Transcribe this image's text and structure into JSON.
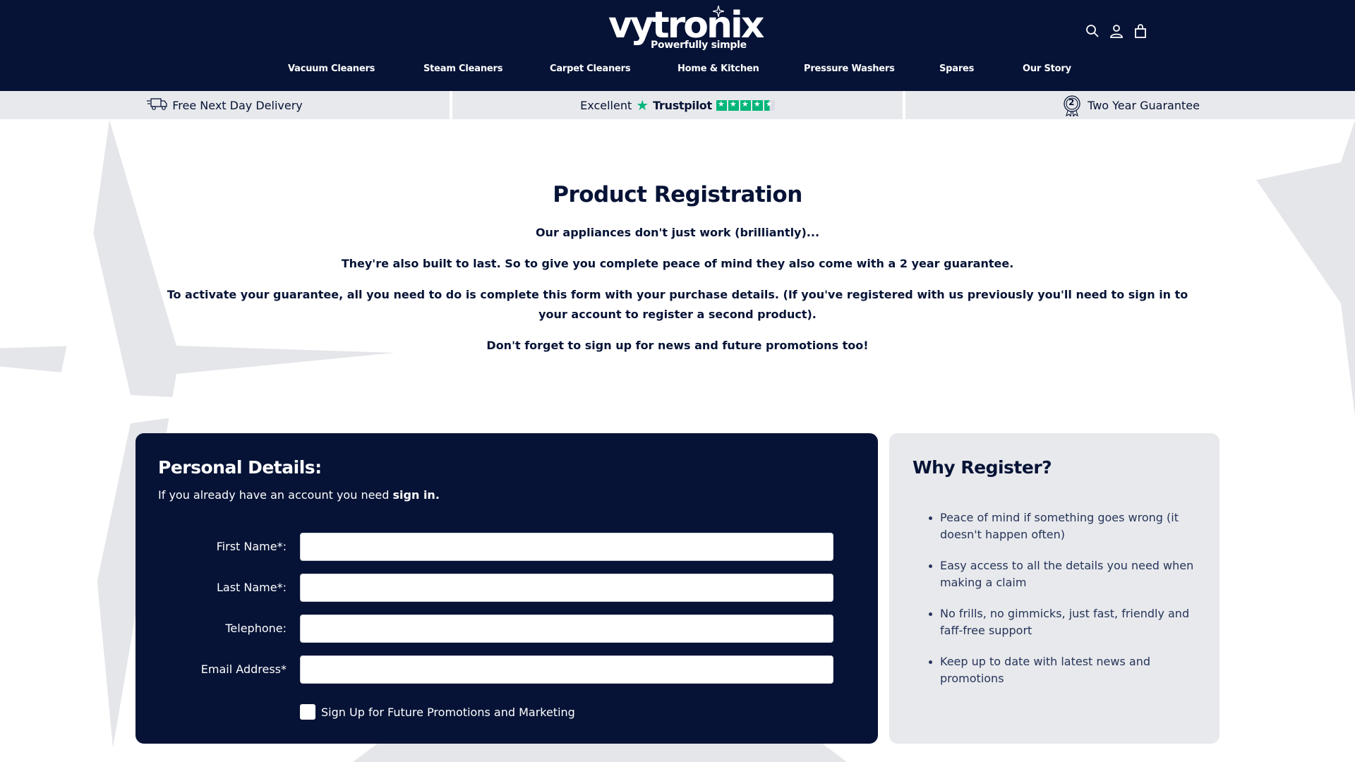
{
  "brand": {
    "name": "vytronix",
    "tagline": "Powerfully simple"
  },
  "header": {
    "icons": [
      "search-icon",
      "account-icon",
      "cart-icon"
    ]
  },
  "nav": {
    "items": [
      {
        "label": "Vacuum Cleaners"
      },
      {
        "label": "Steam Cleaners"
      },
      {
        "label": "Carpet Cleaners"
      },
      {
        "label": "Home & Kitchen"
      },
      {
        "label": "Pressure Washers"
      },
      {
        "label": "Spares"
      },
      {
        "label": "Our Story"
      }
    ]
  },
  "usp": {
    "delivery": "Free Next Day Delivery",
    "trustpilot_rating": "Excellent",
    "trustpilot_brand": "Trustpilot",
    "trustpilot_stars": 4.5,
    "guarantee": "Two Year Guarantee",
    "guarantee_badge": "2"
  },
  "intro": {
    "title": "Product Registration",
    "p1": "Our appliances don't just work (brilliantly)...",
    "p2": "They're also built to last. So to give you complete peace of mind they also come with a 2 year guarantee.",
    "p3": "To activate your guarantee, all you need to do is complete this form with your purchase details. (If you've registered with us previously you'll need to sign in to your account to register a second product).",
    "p4": "Don't forget to sign up for news and future promotions too!"
  },
  "form": {
    "title": "Personal Details:",
    "signin_prefix": "If you already have an account you need ",
    "signin_link": "sign in.",
    "fields": [
      {
        "label": "First Name*:",
        "value": ""
      },
      {
        "label": "Last Name*:",
        "value": ""
      },
      {
        "label": "Telephone:",
        "value": ""
      },
      {
        "label": "Email Address*",
        "value": ""
      }
    ],
    "checkbox_label": "Sign Up for Future Promotions and Marketing",
    "checkbox_checked": false
  },
  "why": {
    "title": "Why Register?",
    "items": [
      "Peace of mind if something goes wrong (it doesn't happen often)",
      "Easy access to all the details you need when making a claim",
      "No frills, no gimmicks, just fast, friendly and faff-free support",
      "Keep up to date with latest news and promotions"
    ]
  },
  "colors": {
    "navy": "#061336",
    "grey_panel": "#e8e9ec",
    "trustpilot_green": "#00b67a"
  }
}
